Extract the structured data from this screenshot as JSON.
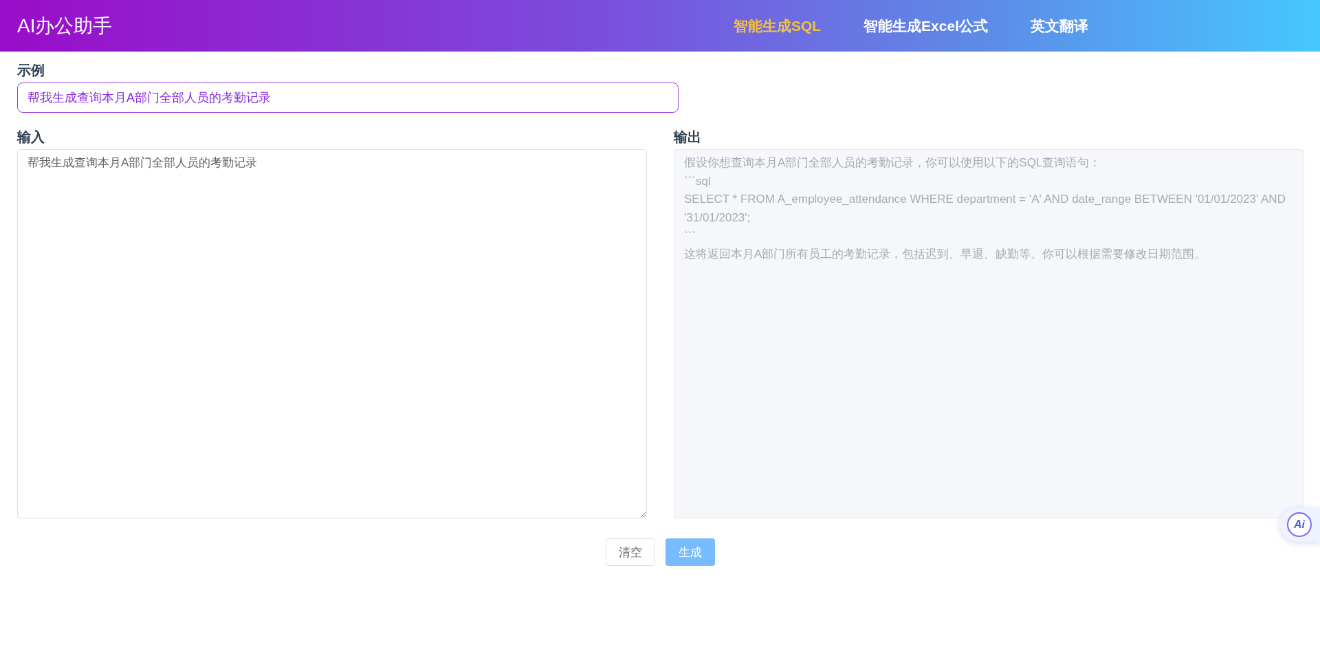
{
  "header": {
    "title": "AI办公助手",
    "nav": [
      {
        "label": "智能生成SQL",
        "selected": true
      },
      {
        "label": "智能生成Excel公式",
        "selected": false
      },
      {
        "label": "英文翻译",
        "selected": false
      }
    ]
  },
  "example": {
    "label": "示例",
    "value": "帮我生成查询本月A部门全部人员的考勤记录"
  },
  "input": {
    "label": "输入",
    "value": "帮我生成查询本月A部门全部人员的考勤记录"
  },
  "output": {
    "label": "输出",
    "disabled": true,
    "lines": [
      "假设你想查询本月A部门全部人员的考勤记录，你可以使用以下的SQL查询语句：",
      "```sql",
      "SELECT * FROM A_employee_attendance WHERE department = 'A' AND date_range BETWEEN '01/01/2023' AND '31/01/2023';",
      "```",
      "这将返回本月A部门所有员工的考勤记录，包括迟到、早退、缺勤等。你可以根据需要修改日期范围。"
    ]
  },
  "buttons": [
    {
      "label": "清空",
      "kind": "plain"
    },
    {
      "label": "生成",
      "kind": "primary",
      "disabled": true
    }
  ],
  "floating_badge": "Ai"
}
